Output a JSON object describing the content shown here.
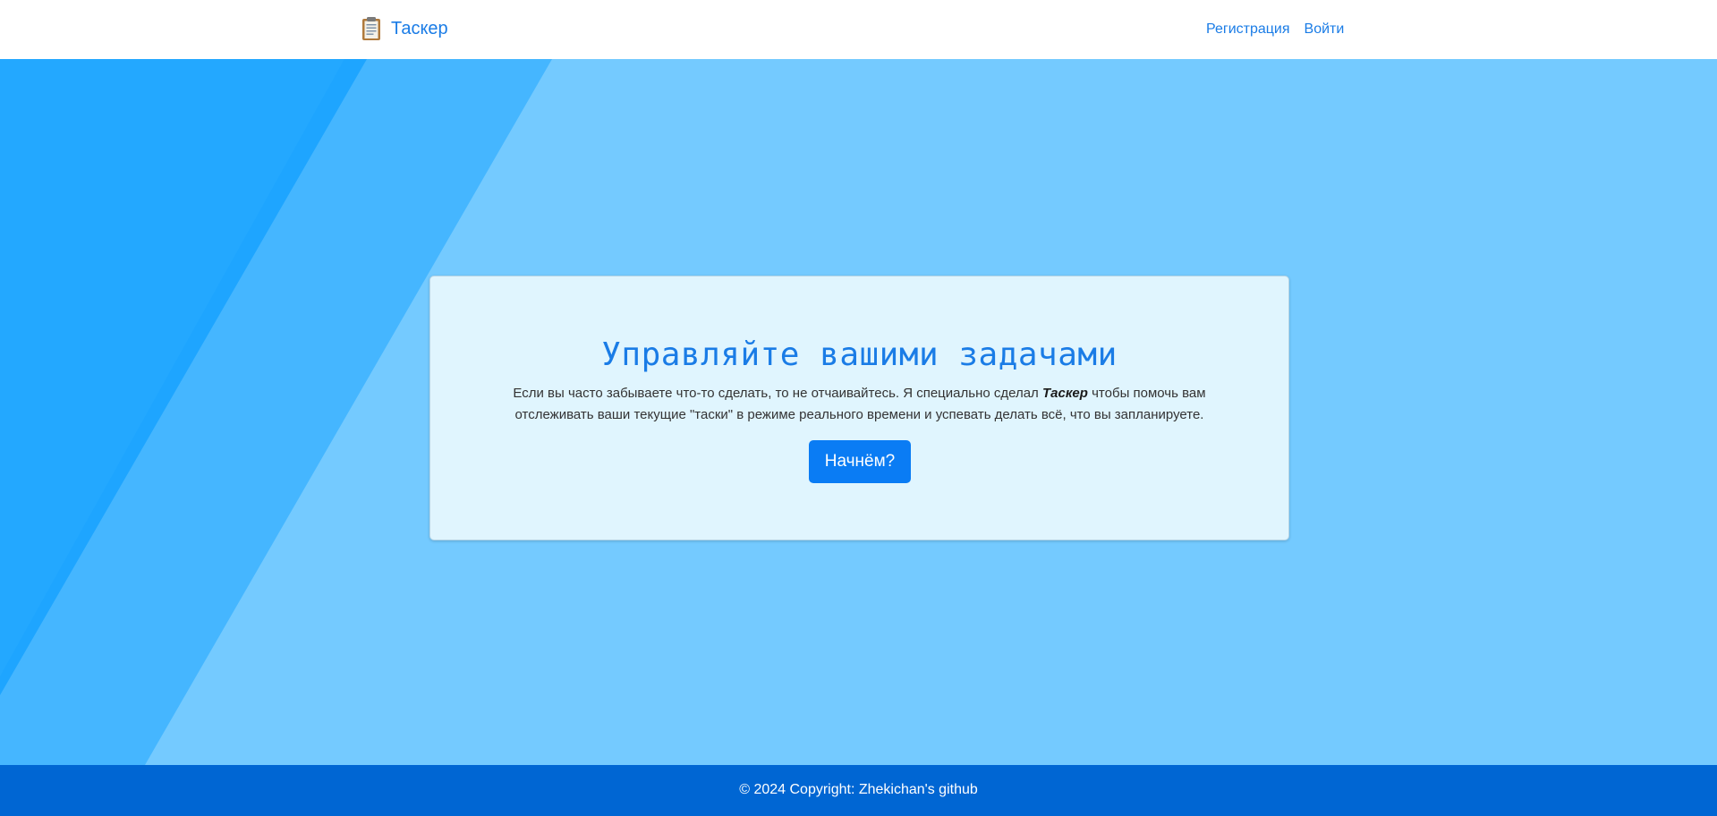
{
  "header": {
    "brand_name": "Таскер",
    "brand_icon": "clipboard-icon",
    "nav": {
      "register_label": "Регистрация",
      "login_label": "Войти"
    }
  },
  "hero": {
    "title": "Управляйте вашими задачами",
    "text_before": "Если вы часто забываете что-то сделать, то не отчаивайтесь. Я специально сделал ",
    "text_brand": "Таскер",
    "text_after": " чтобы помочь вам отслеживать ваши текущие \"таски\" в режиме реального времени и успевать делать всё, что вы запланируете.",
    "button_label": "Начнём?"
  },
  "footer": {
    "copyright": "© 2024 Copyright: Zhekichan's github"
  },
  "colors": {
    "accent": "#1a7ce6",
    "button": "#0a7cf4",
    "background": "#74caff",
    "footer": "#0066d3",
    "card": "#e0f5fe"
  }
}
